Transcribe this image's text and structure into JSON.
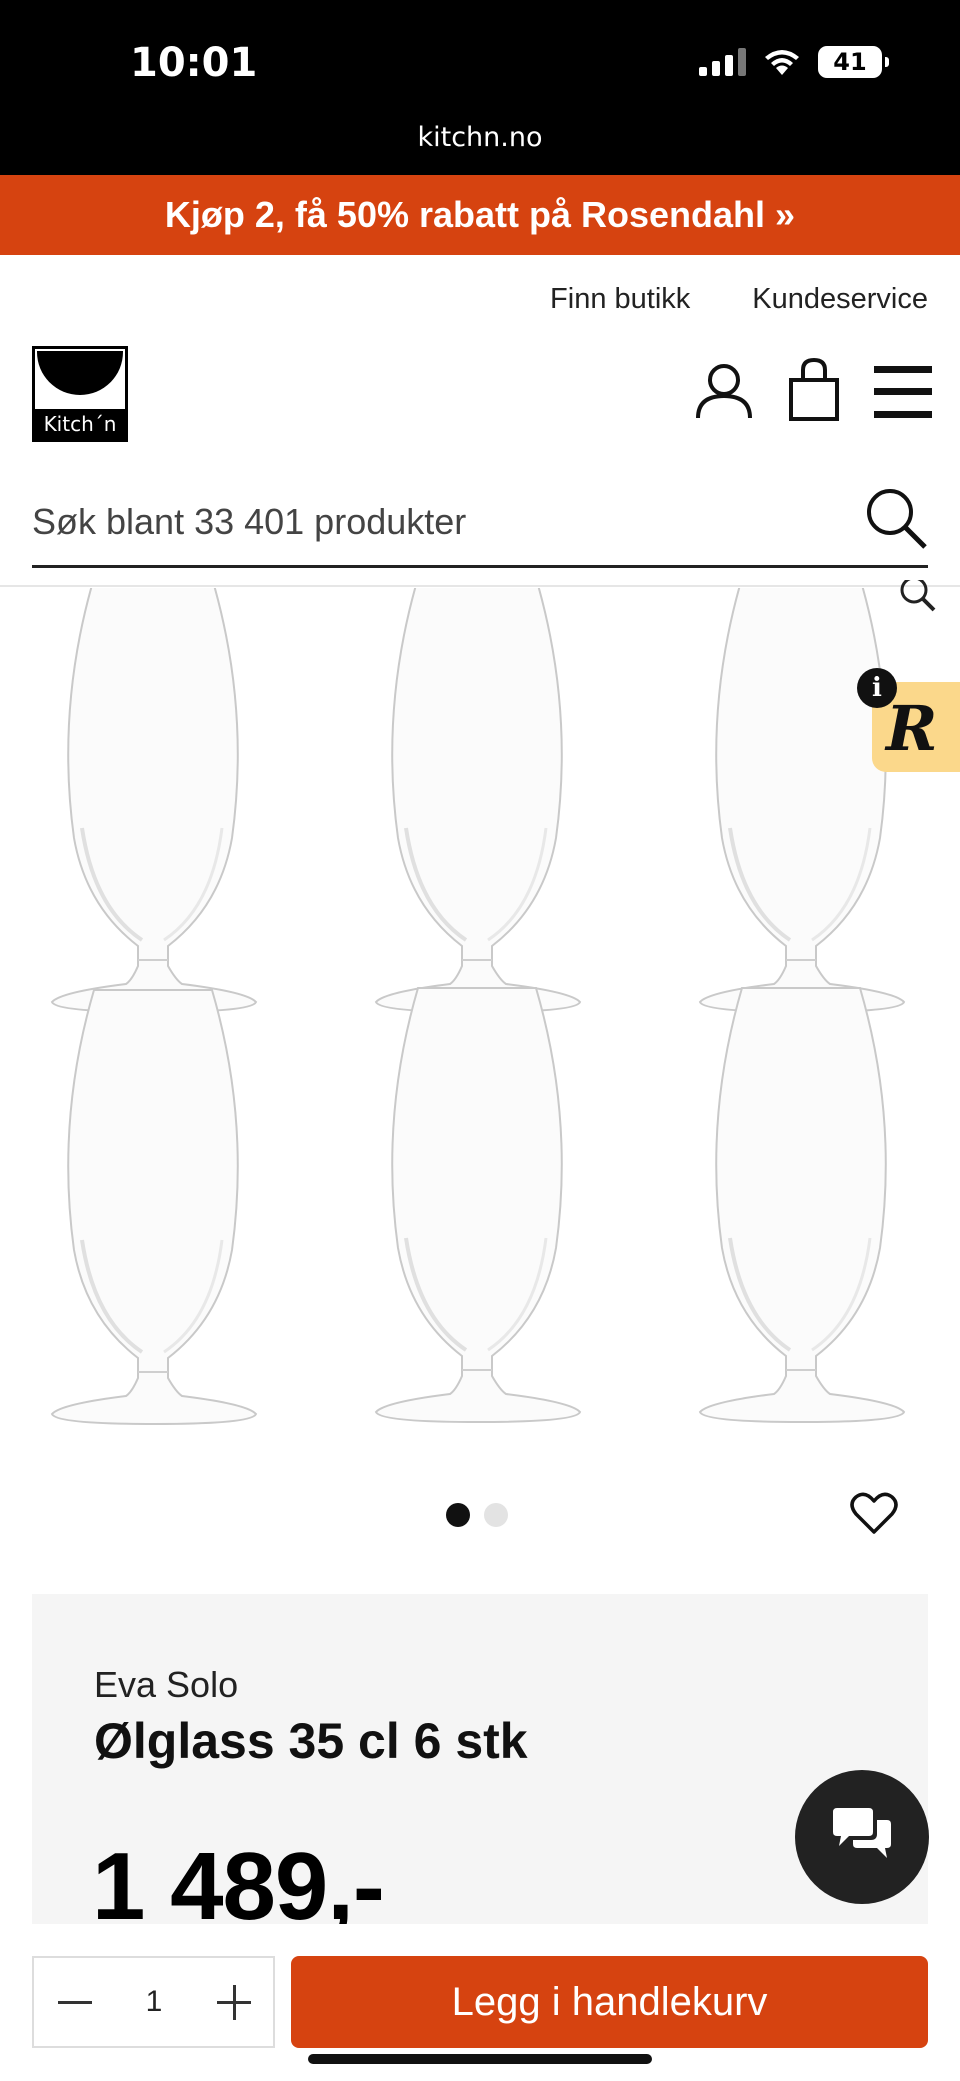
{
  "status_bar": {
    "time": "10:01",
    "battery": "41",
    "url": "kitchn.no"
  },
  "promo": {
    "text": "Kjøp 2, få 50% rabatt på Rosendahl »"
  },
  "header": {
    "links": [
      "Finn butikk",
      "Kundeservice"
    ],
    "logo_text": "Kitch´n",
    "icons": [
      "user-icon",
      "cart-icon",
      "menu-icon"
    ]
  },
  "search": {
    "placeholder": "Søk blant 33 401 produkter"
  },
  "gallery": {
    "image_count": 2,
    "active_index": 0,
    "glasses": 6,
    "badge_letter": "R",
    "info_letter": "i"
  },
  "product": {
    "brand": "Eva Solo",
    "name": "Ølglass 35 cl 6 stk",
    "price": "1 489,-"
  },
  "cart_bar": {
    "quantity": "1",
    "add_label": "Legg i handlekurv"
  },
  "colors": {
    "accent": "#d64310",
    "badge": "#fbd88b",
    "panel": "#f5f5f5"
  }
}
